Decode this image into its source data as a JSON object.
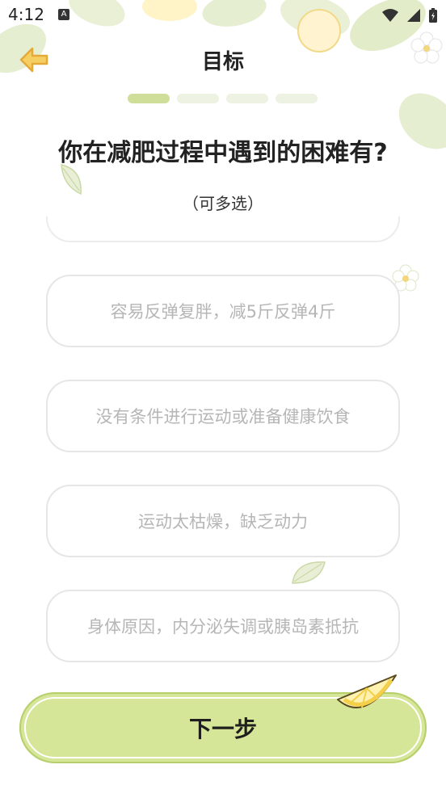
{
  "status": {
    "time": "4:12"
  },
  "header": {
    "title": "目标",
    "progress_total": 4,
    "progress_current": 1
  },
  "question": {
    "text": "你在减肥过程中遇到的困难有?",
    "hint": "（可多选）"
  },
  "options": [
    "容易反弹复胖，减5斤反弹4斤",
    "没有条件进行运动或准备健康饮食",
    "运动太枯燥，缺乏动力",
    "身体原因，内分泌失调或胰岛素抵抗"
  ],
  "footer": {
    "next_label": "下一步"
  },
  "colors": {
    "accent": "#d5e699",
    "progress_active": "#cfdf9a",
    "progress_inactive": "#eef2e2",
    "back_arrow": "#f2c15a"
  }
}
